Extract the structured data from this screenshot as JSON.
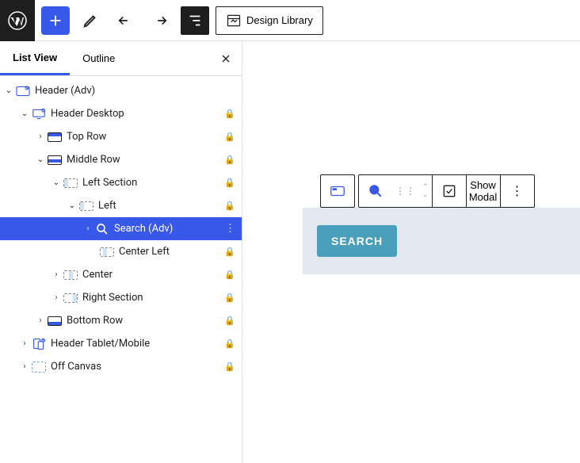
{
  "toolbar": {
    "designLibrary": "Design Library"
  },
  "sidebar": {
    "tabs": {
      "listView": "List View",
      "outline": "Outline"
    },
    "tree": {
      "header": "Header (Adv)",
      "headerDesktop": "Header Desktop",
      "topRow": "Top Row",
      "middleRow": "Middle Row",
      "leftSection": "Left Section",
      "left": "Left",
      "search": "Search (Adv)",
      "centerLeft": "Center Left",
      "center": "Center",
      "rightSection": "Right Section",
      "bottomRow": "Bottom Row",
      "headerTabletMobile": "Header Tablet/Mobile",
      "offCanvas": "Off Canvas"
    }
  },
  "floatingToolbar": {
    "showModal": "Show Modal"
  },
  "canvas": {
    "searchButton": "SEARCH"
  }
}
